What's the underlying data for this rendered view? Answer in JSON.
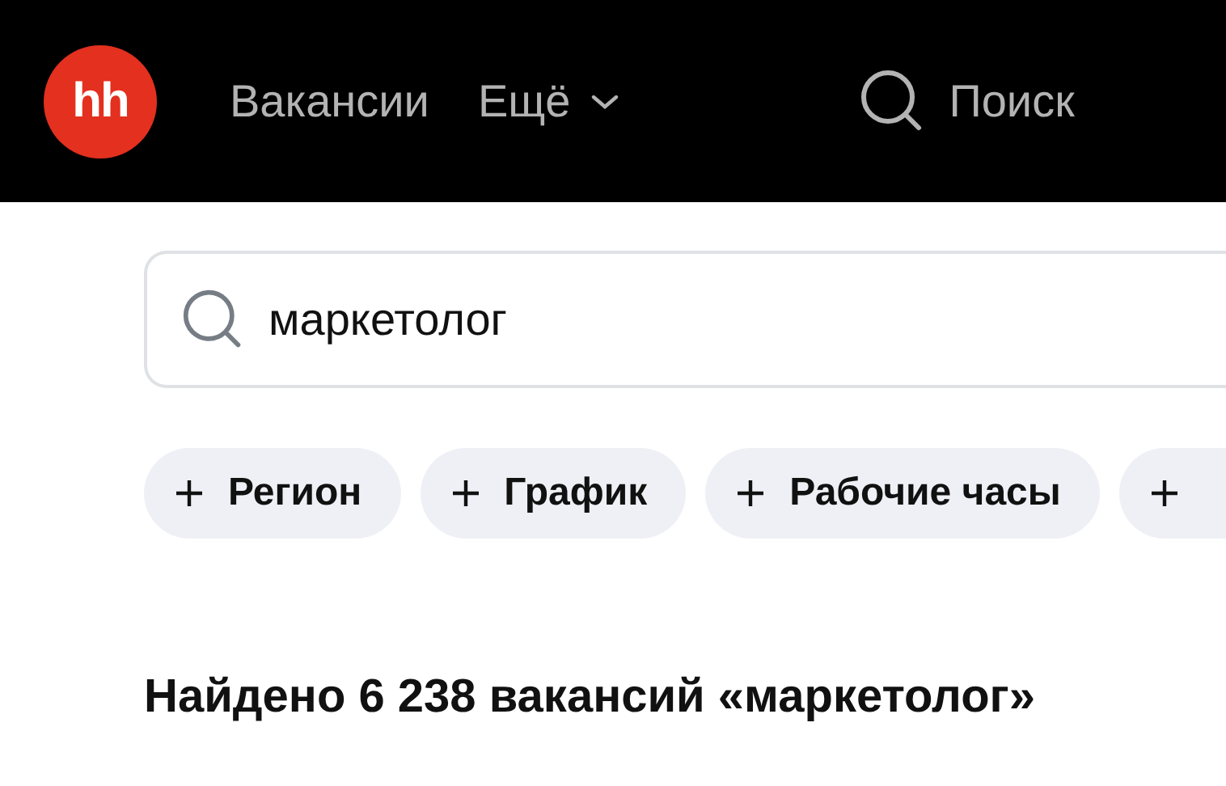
{
  "header": {
    "logo": "hh",
    "nav": [
      {
        "label": "Вакансии",
        "kind": "link"
      },
      {
        "label": "Ещё",
        "kind": "dropdown"
      }
    ],
    "search_link": "Поиск"
  },
  "search": {
    "value": "маркетолог"
  },
  "filters": [
    {
      "kind": "chip",
      "label": "Регион"
    },
    {
      "kind": "chip",
      "label": "График"
    },
    {
      "kind": "chip",
      "label": "Рабочие часы"
    },
    {
      "kind": "cut"
    }
  ],
  "results_heading": "Найдено 6 238 вакансий «маркетолог»"
}
